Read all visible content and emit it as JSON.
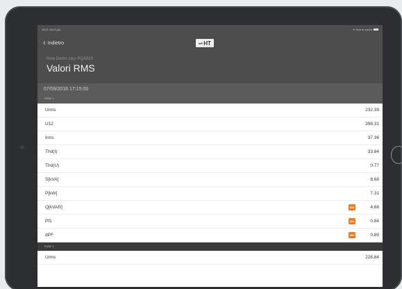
{
  "status_bar": {
    "left": "16:11  Gio 8 giu",
    "right": "Non in carica"
  },
  "nav": {
    "back_label": "Indietro",
    "logo_text": "HT",
    "logo_prefix": "dlP"
  },
  "header": {
    "subtitle": "New Demo step PQA820",
    "title": "Valori RMS"
  },
  "date": "07/09/2016 17:15:00",
  "sections": [
    {
      "label": "FASE 1",
      "rows": [
        {
          "label": "Urms",
          "value": "232.39",
          "badge": false
        },
        {
          "label": "U12",
          "value": "398.31",
          "badge": false
        },
        {
          "label": "Irms",
          "value": "37.36",
          "badge": false
        },
        {
          "label": "Thd(I)",
          "value": "33.84",
          "badge": false
        },
        {
          "label": "Thd(U)",
          "value": "0.77",
          "badge": false
        },
        {
          "label": "S[kVA]",
          "value": "8.68",
          "badge": false
        },
        {
          "label": "P[kW]",
          "value": "7.31",
          "badge": false
        },
        {
          "label": "Q[kVAR]",
          "value": "4.68",
          "badge": true
        },
        {
          "label": "Pf1",
          "value": "0.84",
          "badge": true
        },
        {
          "label": "dPF",
          "value": "0.89",
          "badge": true
        }
      ]
    },
    {
      "label": "FASE 2",
      "rows": [
        {
          "label": "Urms",
          "value": "228.84",
          "badge": false
        }
      ]
    }
  ],
  "badge_text": "IND",
  "colors": {
    "header_bg": "#4d4d4d",
    "date_bg": "#5b5b5b",
    "badge": "#f07a23"
  }
}
